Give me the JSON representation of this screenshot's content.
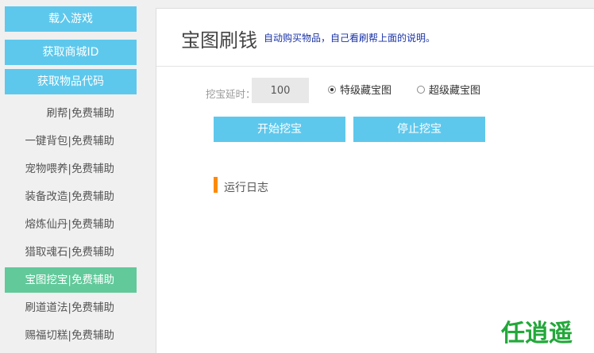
{
  "sidebar": {
    "top_buttons": [
      "载入游戏",
      "获取商城ID",
      "获取物品代码"
    ],
    "items": [
      {
        "label": "刷帮|免费辅助",
        "active": false
      },
      {
        "label": "一键背包|免费辅助",
        "active": false
      },
      {
        "label": "宠物喂养|免费辅助",
        "active": false
      },
      {
        "label": "装备改造|免费辅助",
        "active": false
      },
      {
        "label": "熔炼仙丹|免费辅助",
        "active": false
      },
      {
        "label": "猎取魂石|免费辅助",
        "active": false
      },
      {
        "label": "宝图挖宝|免费辅助",
        "active": true
      },
      {
        "label": "刷道道法|免费辅助",
        "active": false
      },
      {
        "label": "赐福切糕|免费辅助",
        "active": false
      }
    ]
  },
  "main": {
    "title": "宝图刷钱",
    "description": "自动购买物品，自己看刷帮上面的说明。",
    "delay_label": "挖宝延时：",
    "delay_value": "100",
    "radio_options": [
      {
        "label": "特级藏宝图",
        "checked": true
      },
      {
        "label": "超级藏宝图",
        "checked": false
      }
    ],
    "start_button": "开始挖宝",
    "stop_button": "停止挖宝",
    "log_label": "运行日志"
  },
  "watermark": {
    "text": "任逍遥",
    "color": "#22a83a"
  },
  "colors": {
    "accent": "#5ec8ec",
    "active": "#62c99a",
    "log_marker": "#ff8a00",
    "desc": "#1a33a8"
  }
}
